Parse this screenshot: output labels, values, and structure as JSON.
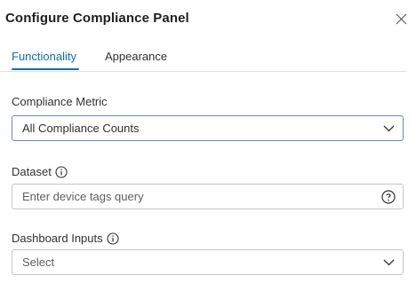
{
  "panel": {
    "title": "Configure Compliance Panel"
  },
  "tabs": [
    {
      "label": "Functionality",
      "active": true
    },
    {
      "label": "Appearance",
      "active": false
    }
  ],
  "fields": {
    "compliance_metric": {
      "label": "Compliance Metric",
      "value": "All Compliance Counts",
      "icon": "chevron-down-icon"
    },
    "dataset": {
      "label": "Dataset",
      "placeholder": "Enter device tags query",
      "label_icon": "info-icon",
      "icon": "help-circle-icon"
    },
    "dashboard_inputs": {
      "label": "Dashboard Inputs",
      "value": "Select",
      "label_icon": "info-icon",
      "icon": "chevron-down-icon"
    }
  },
  "colors": {
    "accent": "#0f6cbd",
    "border": "#c8c6c4",
    "focused_border": "#5b8fcf",
    "text": "#323130"
  }
}
